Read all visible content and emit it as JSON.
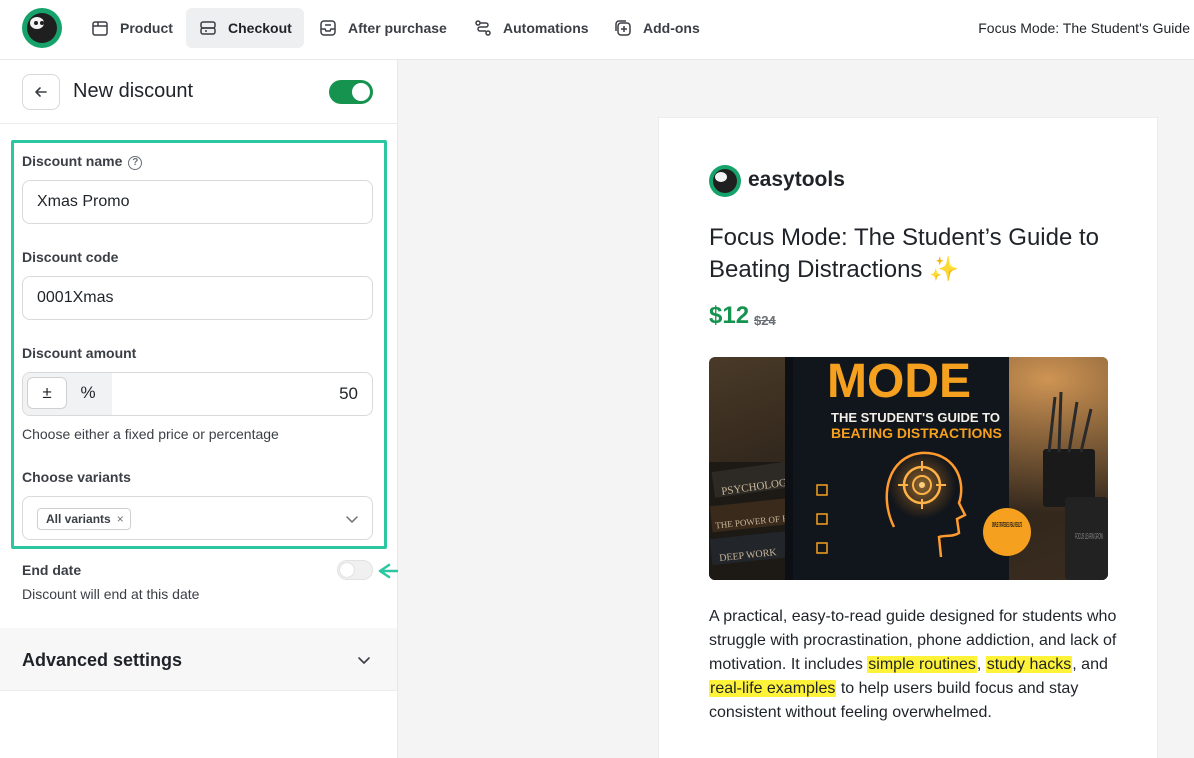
{
  "nav": {
    "tabs": [
      {
        "label": "Product",
        "icon": "box-icon",
        "active": false
      },
      {
        "label": "Checkout",
        "icon": "checkout-icon",
        "active": true
      },
      {
        "label": "After purchase",
        "icon": "inbox-icon",
        "active": false
      },
      {
        "label": "Automations",
        "icon": "automation-icon",
        "active": false
      },
      {
        "label": "Add-ons",
        "icon": "plus-square-icon",
        "active": false
      }
    ],
    "product_title": "Focus Mode: The Student's Guide"
  },
  "panel": {
    "title": "New discount",
    "enabled": true,
    "discount_name_label": "Discount name",
    "discount_name_value": "Xmas Promo",
    "discount_code_label": "Discount code",
    "discount_code_value": "0001Xmas",
    "discount_amount_label": "Discount amount",
    "fixed_symbol": "±",
    "percent_symbol": "%",
    "amount_value": "50",
    "amount_hint": "Choose either a fixed price or percentage",
    "variants_label": "Choose variants",
    "variant_chip": "All variants",
    "variant_chip_remove": "×",
    "end_date_label": "End date",
    "end_date_enabled": false,
    "end_date_hint": "Discount will end at this date",
    "advanced_label": "Advanced settings"
  },
  "preview": {
    "brand": "easytools",
    "title": "Focus Mode: The Student’s Guide to Beating Distractions",
    "title_emoji": "✨",
    "price": "$12",
    "old_price": "$24",
    "cover": {
      "title": "MODE",
      "subtitle_1": "THE STUDENT'S GUIDE TO",
      "subtitle_2": "BEATING DISTRACTIONS",
      "badge": "SIMPLE STRATEGIES. REAL RESULTS",
      "spine_1": "PSYCHOLOGY",
      "spine_2": "THE POWER OF HABIT",
      "spine_3": "DEEP WORK",
      "mug": "FOCUS LEARN GROW"
    },
    "description": {
      "part1": "A practical, easy-to-read guide designed for students who struggle with procrastination, phone addiction, and lack of motivation. It includes ",
      "hl1": "simple routines",
      "sep1": ", ",
      "hl2": "study hacks",
      "sep2": ", and ",
      "hl3": "real-life examples",
      "part2": " to help users build focus and stay consistent without feeling overwhelmed."
    }
  },
  "colors": {
    "accent_green": "#15934f",
    "highlight_border": "#2cc6a0",
    "text_highlight": "#fff33a"
  }
}
